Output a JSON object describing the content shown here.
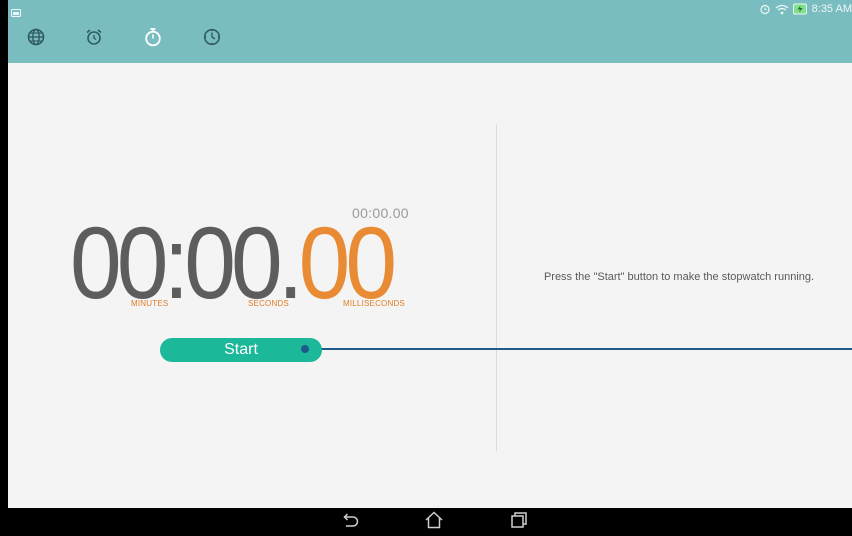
{
  "status_bar": {
    "time": "8:35 AM",
    "icons": [
      "screenshot-icon",
      "alarm-icon",
      "wifi-icon",
      "battery-charging-icon"
    ]
  },
  "tabs": [
    {
      "name": "world-clock",
      "icon": "globe-icon"
    },
    {
      "name": "alarm",
      "icon": "alarm-clock-icon"
    },
    {
      "name": "stopwatch",
      "icon": "stopwatch-icon",
      "active": true
    },
    {
      "name": "timer",
      "icon": "timer-icon"
    }
  ],
  "stopwatch": {
    "lap_time": "00:00.00",
    "minutes": "00",
    "separator_colon": ":",
    "seconds": "00",
    "separator_dot": ".",
    "milliseconds": "00",
    "minutes_label": "MINUTES",
    "seconds_label": "SECONDS",
    "milliseconds_label": "MILLISECONDS",
    "start_label": "Start"
  },
  "hint_text": "Press the \"Start\" button to make the stopwatch running.",
  "nav": [
    "back-icon",
    "home-icon",
    "recent-apps-icon"
  ],
  "colors": {
    "toolbar": "#79bdc1",
    "accent_orange": "#e98a34",
    "start_button": "#1bb89a",
    "pointer_line": "#1e5a8a"
  }
}
